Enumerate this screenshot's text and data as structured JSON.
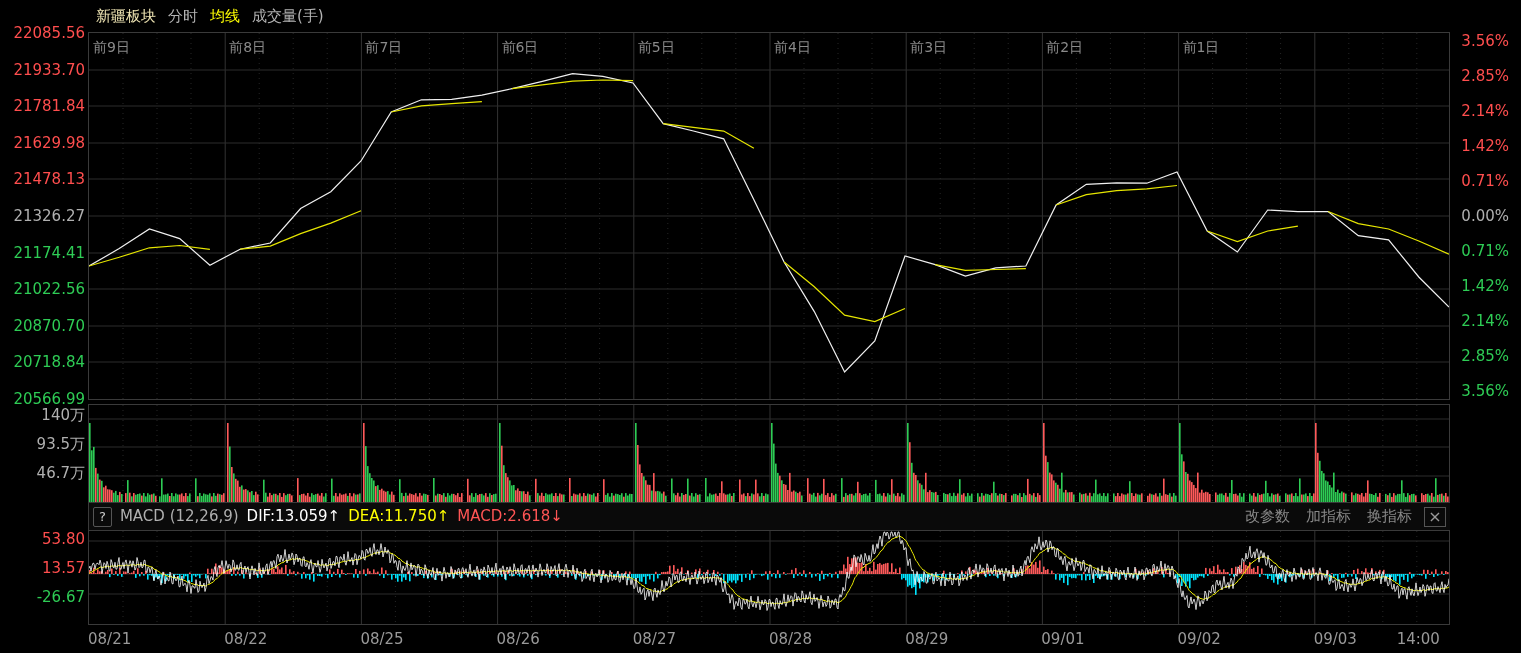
{
  "header": [
    {
      "text": "新疆板块",
      "color": "#f0e6b4"
    },
    {
      "text": "分时",
      "color": "#b4b4b4"
    },
    {
      "text": "均线",
      "color": "#ffff00"
    },
    {
      "text": "成交量(手)",
      "color": "#b4b4b4"
    }
  ],
  "price_panel": {
    "day_labels": [
      "前9日",
      "前8日",
      "前7日",
      "前6日",
      "前5日",
      "前4日",
      "前3日",
      "前2日",
      "前1日"
    ],
    "chart_data": {
      "type": "line",
      "ylim": [
        20566.99,
        22085.56
      ],
      "grid": true,
      "categories": [
        null,
        null,
        null,
        null,
        null,
        null,
        null,
        null,
        null,
        null,
        null,
        null,
        null,
        null,
        null,
        null,
        null,
        null,
        null,
        null,
        null,
        null,
        null,
        null,
        null,
        null,
        null,
        null,
        null,
        null,
        null,
        null,
        null,
        null,
        null,
        null,
        null,
        null,
        null,
        null,
        null,
        null,
        null,
        null,
        null,
        null
      ],
      "series": [
        {
          "color": "#f0f0f0",
          "values": [
            21118.8,
            21191.0,
            21272.8,
            21232.5,
            21122.2,
            21188.6,
            21214.3,
            21357.4,
            21427.1,
            21554.5,
            21757.8,
            21808.4,
            21810.1,
            21827.5,
            21854.9,
            21885.2,
            21917.1,
            21905.5,
            21878.1,
            21709.7,
            21679.0,
            21646.6,
            21393.5,
            21135.4,
            20929.6,
            20679.1,
            20807.7,
            21160.3,
            21124.6,
            21077.3,
            21111.4,
            21118.8,
            21371.9,
            21457.8,
            21464.0,
            21462.4,
            21508.8,
            21264.1,
            21176.9,
            21351.2,
            21344.1,
            21345.0,
            21244.6,
            21227.6,
            21073.2,
            20948.7
          ]
        },
        {
          "color": "#e6e600",
          "values": [
            21118.8,
            21154.9,
            21194.2,
            21203.8,
            21187.5,
            21188.6,
            21201.5,
            21253.4,
            21296.9,
            21348.4,
            21757.8,
            21783.1,
            21792.1,
            21801.0,
            21854.9,
            21870.1,
            21885.7,
            21890.7,
            21888.2,
            21709.7,
            21694.4,
            21678.4,
            21607.2,
            21135.4,
            21032.5,
            20914.7,
            20888.0,
            20942.4,
            21124.6,
            21101.0,
            21104.4,
            21108.0,
            21371.9,
            21414.9,
            21431.2,
            21439.0,
            21453.0,
            21264.1,
            21220.5,
            21264.1,
            21284.1,
            21345.0,
            21294.8,
            21272.4,
            21222.6,
            21167.8
          ]
        }
      ],
      "yticks": [
        {
          "value": 22085.56,
          "label": "22085.56"
        },
        {
          "value": 21933.7,
          "label": "21933.70"
        },
        {
          "value": 21781.84,
          "label": "21781.84"
        },
        {
          "value": 21629.98,
          "label": "21629.98"
        },
        {
          "value": 21478.13,
          "label": "21478.13"
        },
        {
          "value": 21326.27,
          "label": "21326.27"
        },
        {
          "value": 21174.41,
          "label": "21174.41"
        },
        {
          "value": 21022.56,
          "label": "21022.56"
        },
        {
          "value": 20870.7,
          "label": "20870.70"
        },
        {
          "value": 20718.84,
          "label": "20718.84"
        },
        {
          "value": 20566.99,
          "label": "20566.99"
        }
      ]
    },
    "right_ticks": [
      {
        "text": "3.56%",
        "kind": "up"
      },
      {
        "text": "2.85%",
        "kind": "up"
      },
      {
        "text": "2.14%",
        "kind": "up"
      },
      {
        "text": "1.42%",
        "kind": "up"
      },
      {
        "text": "0.71%",
        "kind": "up"
      },
      {
        "text": "0.00%",
        "kind": "flat"
      },
      {
        "text": "0.71%",
        "kind": "down"
      },
      {
        "text": "1.42%",
        "kind": "down"
      },
      {
        "text": "2.14%",
        "kind": "down"
      },
      {
        "text": "2.85%",
        "kind": "down"
      },
      {
        "text": "3.56%",
        "kind": "down"
      }
    ]
  },
  "volume_panel": {
    "ticks": [
      "140万",
      "93.5万",
      "46.7万"
    ]
  },
  "macd_bar": {
    "help": "?",
    "name": "MACD (12,26,9)",
    "values": [
      {
        "text": "DIF:13.059↑",
        "color": "#ffffff"
      },
      {
        "text": "DEA:11.750↑",
        "color": "#ffff00"
      },
      {
        "text": "MACD:2.618↓",
        "color": "#ff5555"
      }
    ],
    "buttons": [
      "改参数",
      "加指标",
      "换指标"
    ],
    "close": "×"
  },
  "macd_panel": {
    "ticks": [
      {
        "text": "53.80",
        "kind": "up"
      },
      {
        "text": "13.57",
        "kind": "up"
      },
      {
        "text": "-26.67",
        "kind": "down"
      }
    ]
  },
  "dates": [
    "08/21",
    "08/22",
    "08/25",
    "08/26",
    "08/27",
    "08/28",
    "08/29",
    "09/01",
    "09/02",
    "09/03",
    "14:00"
  ]
}
